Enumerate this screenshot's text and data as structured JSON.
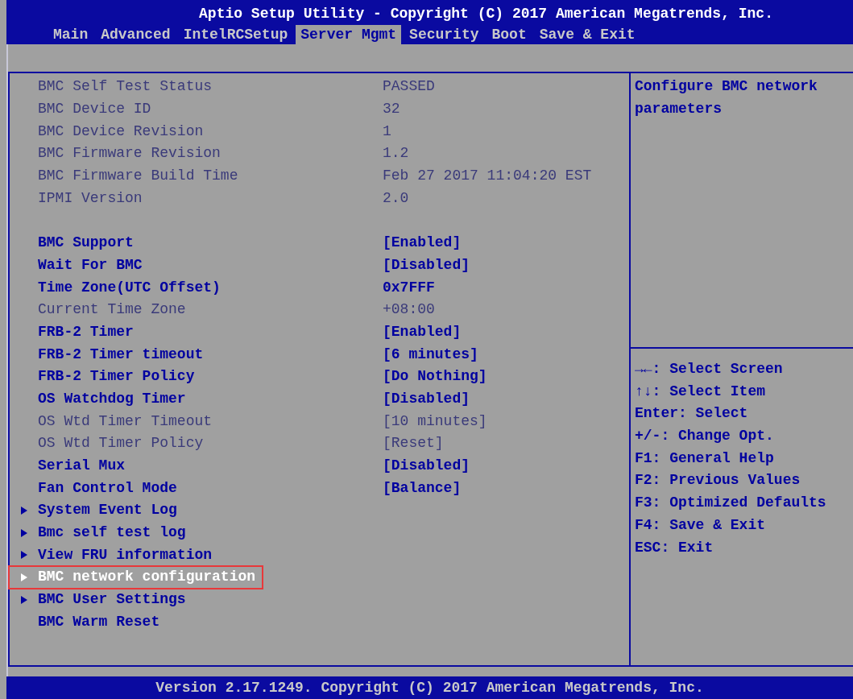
{
  "title": "Aptio Setup Utility - Copyright (C) 2017 American Megatrends, Inc.",
  "tabs": [
    {
      "label": "Main",
      "selected": false
    },
    {
      "label": "Advanced",
      "selected": false
    },
    {
      "label": "IntelRCSetup",
      "selected": false
    },
    {
      "label": "Server Mgmt",
      "selected": true
    },
    {
      "label": "Security",
      "selected": false
    },
    {
      "label": "Boot",
      "selected": false
    },
    {
      "label": "Save & Exit",
      "selected": false
    }
  ],
  "groups": [
    {
      "items": [
        {
          "kind": "setting",
          "label": "BMC Self Test Status",
          "value": "PASSED",
          "disabled": true,
          "selected": false
        },
        {
          "kind": "setting",
          "label": "BMC Device ID",
          "value": "32",
          "disabled": true,
          "selected": false
        },
        {
          "kind": "setting",
          "label": "BMC Device Revision",
          "value": "1",
          "disabled": true,
          "selected": false
        },
        {
          "kind": "setting",
          "label": "BMC Firmware Revision",
          "value": "1.2",
          "disabled": true,
          "selected": false
        },
        {
          "kind": "setting",
          "label": "BMC Firmware Build Time",
          "value": "Feb 27 2017 11:04:20 EST",
          "disabled": true,
          "selected": false
        },
        {
          "kind": "setting",
          "label": "IPMI Version",
          "value": "2.0",
          "disabled": true,
          "selected": false
        }
      ]
    },
    {
      "items": [
        {
          "kind": "setting",
          "label": "BMC Support",
          "value": "[Enabled]",
          "disabled": false,
          "selected": false
        },
        {
          "kind": "setting",
          "label": "Wait For BMC",
          "value": "[Disabled]",
          "disabled": false,
          "selected": false
        },
        {
          "kind": "setting",
          "label": "Time Zone(UTC Offset)",
          "value": "0x7FFF",
          "disabled": false,
          "selected": false
        },
        {
          "kind": "setting",
          "label": "Current Time Zone",
          "value": "+08:00",
          "disabled": true,
          "selected": false
        },
        {
          "kind": "setting",
          "label": "FRB-2 Timer",
          "value": "[Enabled]",
          "disabled": false,
          "selected": false
        },
        {
          "kind": "setting",
          "label": "FRB-2 Timer timeout",
          "value": "[6 minutes]",
          "disabled": false,
          "selected": false
        },
        {
          "kind": "setting",
          "label": "FRB-2 Timer Policy",
          "value": "[Do Nothing]",
          "disabled": false,
          "selected": false
        },
        {
          "kind": "setting",
          "label": "OS Watchdog Timer",
          "value": "[Disabled]",
          "disabled": false,
          "selected": false
        },
        {
          "kind": "setting",
          "label": "OS Wtd Timer Timeout",
          "value": "[10 minutes]",
          "disabled": true,
          "selected": false
        },
        {
          "kind": "setting",
          "label": "OS Wtd Timer Policy",
          "value": "[Reset]",
          "disabled": true,
          "selected": false
        },
        {
          "kind": "setting",
          "label": "Serial Mux",
          "value": "[Disabled]",
          "disabled": false,
          "selected": false
        },
        {
          "kind": "setting",
          "label": "Fan Control Mode",
          "value": "[Balance]",
          "disabled": false,
          "selected": false
        },
        {
          "kind": "submenu",
          "label": "System Event Log",
          "disabled": false,
          "selected": false
        },
        {
          "kind": "submenu",
          "label": "Bmc self test log",
          "disabled": false,
          "selected": false
        },
        {
          "kind": "submenu",
          "label": "View FRU information",
          "disabled": false,
          "selected": false
        },
        {
          "kind": "submenu",
          "label": "BMC network configuration",
          "disabled": false,
          "selected": true
        },
        {
          "kind": "submenu",
          "label": "BMC User Settings",
          "disabled": false,
          "selected": false
        },
        {
          "kind": "action",
          "label": "BMC Warm Reset",
          "disabled": false,
          "selected": false
        }
      ]
    }
  ],
  "help_text": "Configure BMC network parameters",
  "key_help": [
    "→←: Select Screen",
    "↑↓: Select Item",
    "Enter: Select",
    "+/-: Change Opt.",
    "F1: General Help",
    "F2: Previous Values",
    "F3: Optimized Defaults",
    "F4: Save & Exit",
    "ESC: Exit"
  ],
  "footer": "Version 2.17.1249. Copyright (C) 2017 American Megatrends, Inc."
}
